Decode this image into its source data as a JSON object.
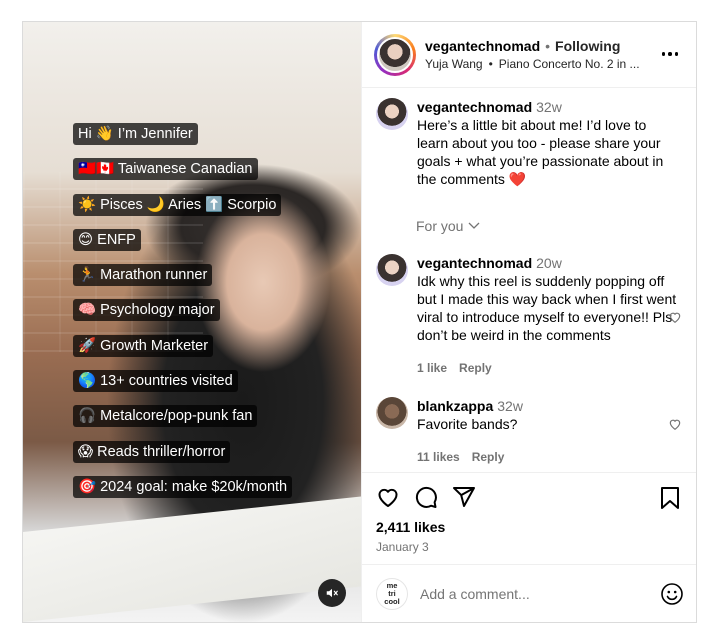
{
  "media": {
    "captions": [
      "Hi 👋 I’m Jennifer",
      "🇹🇼🇨🇦 Taiwanese Canadian",
      "☀️ Pisces 🌙 Aries ⬆️ Scorpio",
      "😊 ENFP",
      "🏃 Marathon runner",
      "🧠 Psychology major",
      "🚀 Growth Marketer",
      "🌎 13+ countries visited",
      "🎧 Metalcore/pop-punk fan",
      "😱 Reads thriller/horror",
      "🎯 2024 goal: make $20k/month"
    ],
    "mute_icon": "speaker-muted-icon"
  },
  "header": {
    "username": "vegantechnomad",
    "separator": "•",
    "follow_status": "Following",
    "audio_artist": "Yuja Wang",
    "audio_title": "Piano Concerto No. 2 in ..."
  },
  "comments": [
    {
      "user": "vegantechnomad",
      "time": "32w",
      "text": "Here’s a little bit about me! I’d love to learn about you too - please share your goals + what you’re passionate about in the comments ❤️"
    },
    {
      "user": "vegantechnomad",
      "time": "20w",
      "text": "Idk why this reel is suddenly popping off but I made this way back when I first went viral to introduce myself to everyone!! Pls don’t be weird in the comments",
      "likes": "1 like",
      "reply": "Reply"
    },
    {
      "user": "blankzappa",
      "time": "32w",
      "text": "Favorite bands?",
      "likes": "11 likes",
      "reply": "Reply"
    }
  ],
  "for_you": "For you",
  "actions": {
    "likes": "2,411 likes",
    "date": "January 3"
  },
  "add_comment": {
    "placeholder": "Add a comment...",
    "logo_text_1": "me",
    "logo_text_2": "tri",
    "logo_text_3": "cool"
  }
}
